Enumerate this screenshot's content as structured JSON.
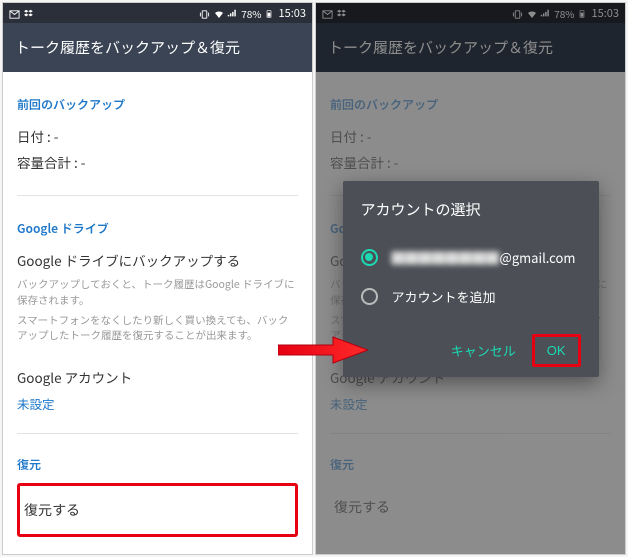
{
  "status": {
    "battery_pct": "78%",
    "time": "15:03"
  },
  "appbar": {
    "title": "トーク履歴をバックアップ＆復元"
  },
  "sections": {
    "last_backup_title": "前回のバックアップ",
    "date_label": "日付 : -",
    "size_label": "容量合計 : -",
    "gdrive_title": "Google ドライブ",
    "gdrive_backup": "Google ドライブにバックアップする",
    "gdrive_desc1": "バックアップしておくと、トーク履歴はGoogle ドライブに保存されます。",
    "gdrive_desc2": "スマートフォンをなくしたり新しく買い換えても、バックアップしたトーク履歴を復元することが出来ます。",
    "gaccount_label": "Google アカウント",
    "gaccount_value": "未設定",
    "restore_title": "復元",
    "restore_action": "復元する"
  },
  "dialog": {
    "title": "アカウントの選択",
    "option1_hidden": "████████",
    "option1_domain": "@gmail.com",
    "option2": "アカウントを追加",
    "cancel": "キャンセル",
    "ok": "OK"
  }
}
